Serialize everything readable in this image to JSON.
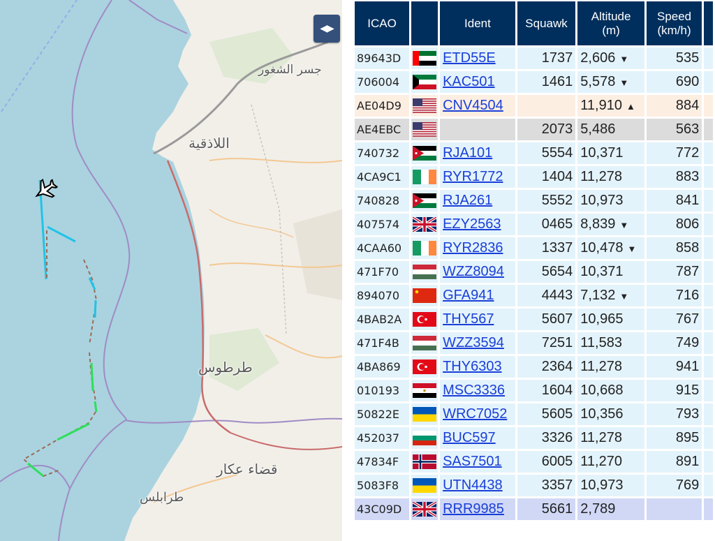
{
  "map": {
    "toggle_label": "◀▶",
    "cities": [
      {
        "name": "جسر الشغور"
      },
      {
        "name": "اللاذقية"
      },
      {
        "name": "طرطوس"
      },
      {
        "name": "قضاء عكار"
      },
      {
        "name": "طرابلس"
      }
    ],
    "aircraft_icon": "plane-icon",
    "colors": {
      "sea": "#aad3df",
      "land": "#f2efe9",
      "track_cyan": "#21c3e6",
      "track_green": "#2de05a",
      "track_dashed": "#9b6b55",
      "border": "#a08bc4",
      "coastal_road": "#c96b6b"
    }
  },
  "table": {
    "columns": {
      "icao": "ICAO",
      "flag": "",
      "ident": "Ident",
      "squawk": "Squawk",
      "altitude": "Altitude",
      "altitude_unit": "(m)",
      "speed": "Speed",
      "speed_unit": "(km/h)"
    },
    "rows": [
      {
        "icao": "89643D",
        "flag": "uae",
        "ident": "ETD55E",
        "squawk": "1737",
        "altitude": "2,606",
        "trend": "▼",
        "speed": "535",
        "style": "n"
      },
      {
        "icao": "706004",
        "flag": "kuwait",
        "ident": "KAC501",
        "squawk": "1461",
        "altitude": "5,578",
        "trend": "▼",
        "speed": "690",
        "style": "n"
      },
      {
        "icao": "AE04D9",
        "flag": "usa",
        "ident": "CNV4504",
        "squawk": "",
        "altitude": "11,910",
        "trend": "▲",
        "speed": "884",
        "style": "warn"
      },
      {
        "icao": "AE4EBC",
        "flag": "usa",
        "ident": "",
        "squawk": "2073",
        "altitude": "5,486",
        "trend": "",
        "speed": "563",
        "style": "gray"
      },
      {
        "icao": "740732",
        "flag": "jordan",
        "ident": "RJA101",
        "squawk": "5554",
        "altitude": "10,371",
        "trend": "",
        "speed": "772",
        "style": "n"
      },
      {
        "icao": "4CA9C1",
        "flag": "ireland",
        "ident": "RYR1772",
        "squawk": "1404",
        "altitude": "11,278",
        "trend": "",
        "speed": "883",
        "style": "n"
      },
      {
        "icao": "740828",
        "flag": "jordan",
        "ident": "RJA261",
        "squawk": "5552",
        "altitude": "10,973",
        "trend": "",
        "speed": "841",
        "style": "n"
      },
      {
        "icao": "407574",
        "flag": "uk",
        "ident": "EZY2563",
        "squawk": "0465",
        "altitude": "8,839",
        "trend": "▼",
        "speed": "806",
        "style": "n"
      },
      {
        "icao": "4CAA60",
        "flag": "ireland",
        "ident": "RYR2836",
        "squawk": "1337",
        "altitude": "10,478",
        "trend": "▼",
        "speed": "858",
        "style": "n"
      },
      {
        "icao": "471F70",
        "flag": "hungary",
        "ident": "WZZ8094",
        "squawk": "5654",
        "altitude": "10,371",
        "trend": "",
        "speed": "787",
        "style": "n"
      },
      {
        "icao": "894070",
        "flag": "china",
        "ident": "GFA941",
        "squawk": "4443",
        "altitude": "7,132",
        "trend": "▼",
        "speed": "716",
        "style": "n"
      },
      {
        "icao": "4BAB2A",
        "flag": "turkey",
        "ident": "THY567",
        "squawk": "5607",
        "altitude": "10,965",
        "trend": "",
        "speed": "767",
        "style": "n"
      },
      {
        "icao": "471F4B",
        "flag": "hungary",
        "ident": "WZZ3594",
        "squawk": "7251",
        "altitude": "11,583",
        "trend": "",
        "speed": "749",
        "style": "n"
      },
      {
        "icao": "4BA869",
        "flag": "turkey",
        "ident": "THY6303",
        "squawk": "2364",
        "altitude": "11,278",
        "trend": "",
        "speed": "941",
        "style": "n"
      },
      {
        "icao": "010193",
        "flag": "egypt",
        "ident": "MSC3336",
        "squawk": "1604",
        "altitude": "10,668",
        "trend": "",
        "speed": "915",
        "style": "n"
      },
      {
        "icao": "50822E",
        "flag": "ukraine",
        "ident": "WRC7052",
        "squawk": "5605",
        "altitude": "10,356",
        "trend": "",
        "speed": "793",
        "style": "n"
      },
      {
        "icao": "452037",
        "flag": "bulgaria",
        "ident": "BUC597",
        "squawk": "3326",
        "altitude": "11,278",
        "trend": "",
        "speed": "895",
        "style": "n"
      },
      {
        "icao": "47834F",
        "flag": "norway",
        "ident": "SAS7501",
        "squawk": "6005",
        "altitude": "11,270",
        "trend": "",
        "speed": "891",
        "style": "n"
      },
      {
        "icao": "5083F8",
        "flag": "ukraine",
        "ident": "UTN4438",
        "squawk": "3357",
        "altitude": "10,973",
        "trend": "",
        "speed": "769",
        "style": "n"
      },
      {
        "icao": "43C09D",
        "flag": "uk",
        "ident": "RRR9985",
        "squawk": "5661",
        "altitude": "2,789",
        "trend": "",
        "speed": "",
        "style": "sel"
      }
    ]
  }
}
